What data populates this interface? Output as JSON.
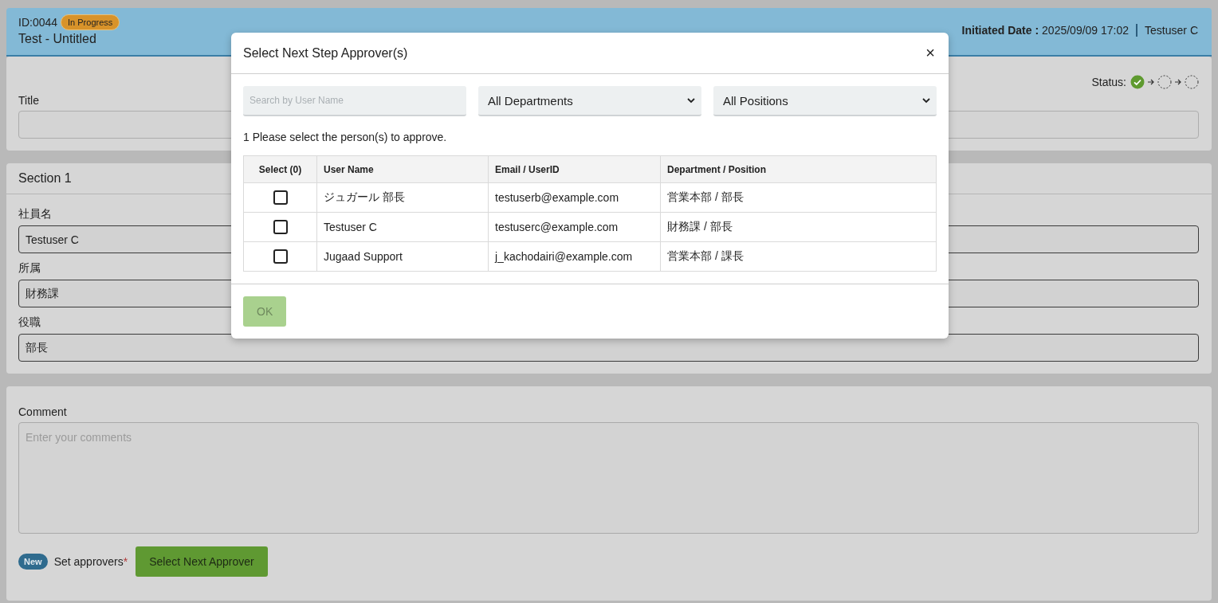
{
  "header": {
    "id": "ID:0044",
    "status_badge": "In Progress",
    "title": "Test - Untitled",
    "initiated_label": "Initiated Date :",
    "initiated_date": "2025/09/09 17:02",
    "user": "Testuser C"
  },
  "status": {
    "label": "Status:",
    "steps": [
      {
        "done": true
      },
      {
        "done": false
      },
      {
        "done": false
      }
    ]
  },
  "title_field": {
    "label": "Title"
  },
  "section": {
    "title": "Section 1",
    "fields": [
      {
        "label": "社員名",
        "value": "Testuser C"
      },
      {
        "label": "所属",
        "value": "財務課"
      },
      {
        "label": "役職",
        "value": "部長"
      }
    ]
  },
  "comment": {
    "label": "Comment",
    "placeholder": "Enter your comments"
  },
  "approvers": {
    "badge": "New",
    "label": "Set approvers",
    "required_mark": "*",
    "button": "Select Next Approver"
  },
  "modal": {
    "title": "Select Next Step Approver(s)",
    "close": "×",
    "search": {
      "placeholder": "Search by User Name"
    },
    "filters": [
      "All Departments",
      "All Positions"
    ],
    "instruction": "1 Please select the person(s) to approve.",
    "columns": [
      "Select (0)",
      "User Name",
      "Email / UserID",
      "Department / Position"
    ],
    "rows": [
      {
        "checked": false,
        "name": "ジュガール 部長",
        "email": "testuserb@example.com",
        "dept": "営業本部 / 部長"
      },
      {
        "checked": false,
        "name": "Testuser C",
        "email": "testuserc@example.com",
        "dept": "財務課 / 部長"
      },
      {
        "checked": false,
        "name": "Jugaad Support",
        "email": "j_kachodairi@example.com",
        "dept": "営業本部 / 課長"
      }
    ],
    "ok": {
      "label": "OK",
      "disabled": true
    }
  }
}
